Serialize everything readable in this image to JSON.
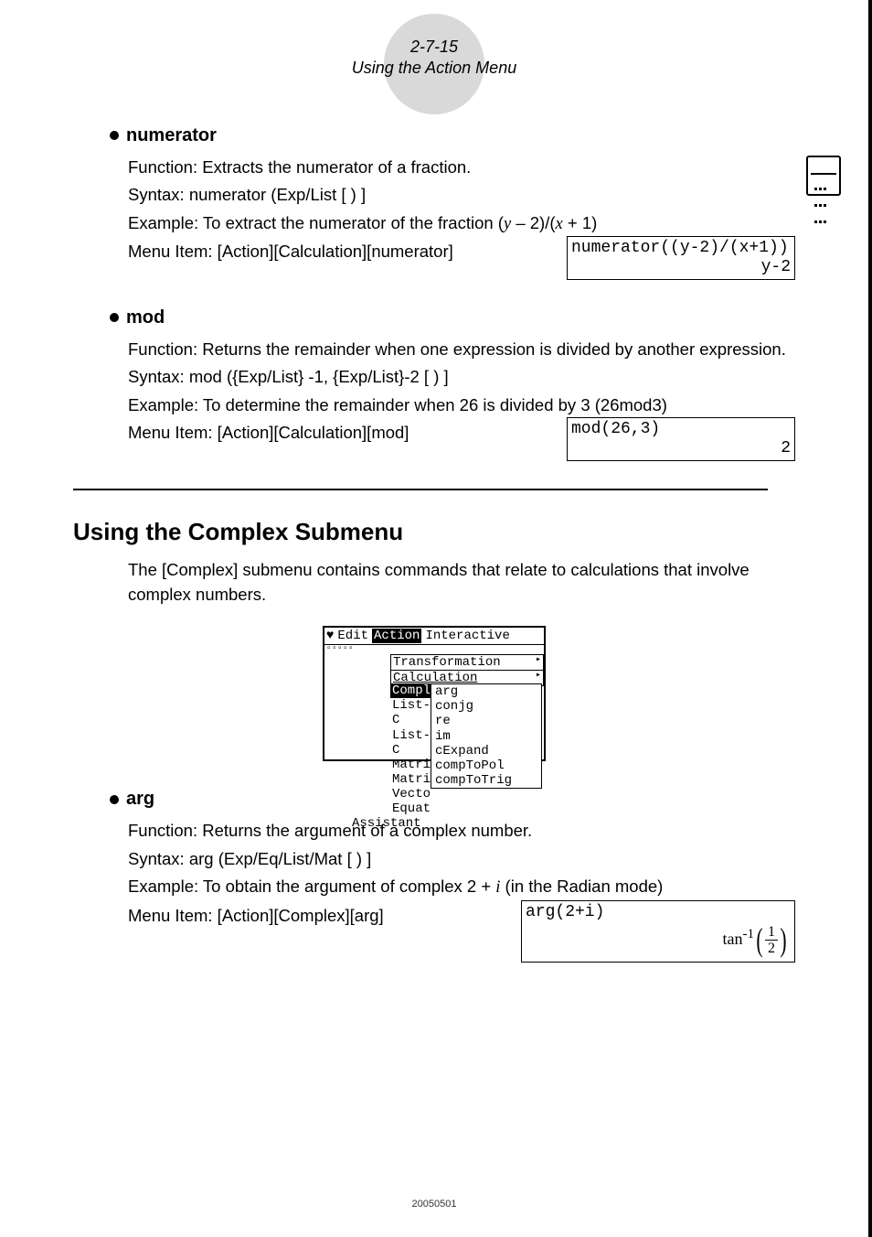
{
  "header": {
    "page_ref": "2-7-15",
    "title": "Using the Action Menu"
  },
  "numerator": {
    "title": "numerator",
    "function": "Function: Extracts the numerator of a fraction.",
    "syntax": "Syntax: numerator (Exp/List [ ) ]",
    "example_prefix": "Example: To extract the numerator of the fraction (",
    "example_mid1": "y",
    "example_mid2": " – 2)/(",
    "example_mid3": "x",
    "example_suffix": " + 1)",
    "menu": "Menu Item: [Action][Calculation][numerator]",
    "screen_line1": "numerator((y-2)/(x+1))",
    "screen_line2": "y-2"
  },
  "mod": {
    "title": "mod",
    "function": "Function: Returns the remainder when one expression is divided by another expression.",
    "syntax": "Syntax: mod ({Exp/List} -1, {Exp/List}-2 [ ) ]",
    "example": "Example: To determine the remainder when 26 is divided by 3 (26mod3)",
    "menu": "Menu Item: [Action][Calculation][mod]",
    "screen_line1": "mod(26,3)",
    "screen_line2": "2"
  },
  "complex": {
    "heading": "Using the Complex Submenu",
    "intro": "The [Complex] submenu contains commands that relate to calculations that involve complex numbers."
  },
  "menushot": {
    "top": [
      "♥",
      "Edit",
      "Action",
      "Interactive"
    ],
    "pane": [
      "Transformation",
      "Calculation"
    ],
    "left_list": [
      "Compl",
      "List-C",
      "List-C",
      "Matri",
      "Matri",
      "Vecto",
      "Equat",
      "Assistant"
    ],
    "sub": [
      "arg",
      "conjg",
      "re",
      "im",
      "cExpand",
      "compToPol",
      "compToTrig"
    ]
  },
  "arg": {
    "title": "arg",
    "function": "Function: Returns the argument of a complex number.",
    "syntax": "Syntax: arg (Exp/Eq/List/Mat [ ) ]",
    "example_prefix": "Example: To obtain the argument of complex 2 + ",
    "example_i": "i",
    "example_suffix": " (in the Radian mode)",
    "menu": "Menu Item: [Action][Complex][arg]",
    "screen_line1": "arg(2+i)",
    "result_prefix": "tan",
    "result_exp": "-1",
    "frac_n": "1",
    "frac_d": "2"
  },
  "footer": "20050501"
}
